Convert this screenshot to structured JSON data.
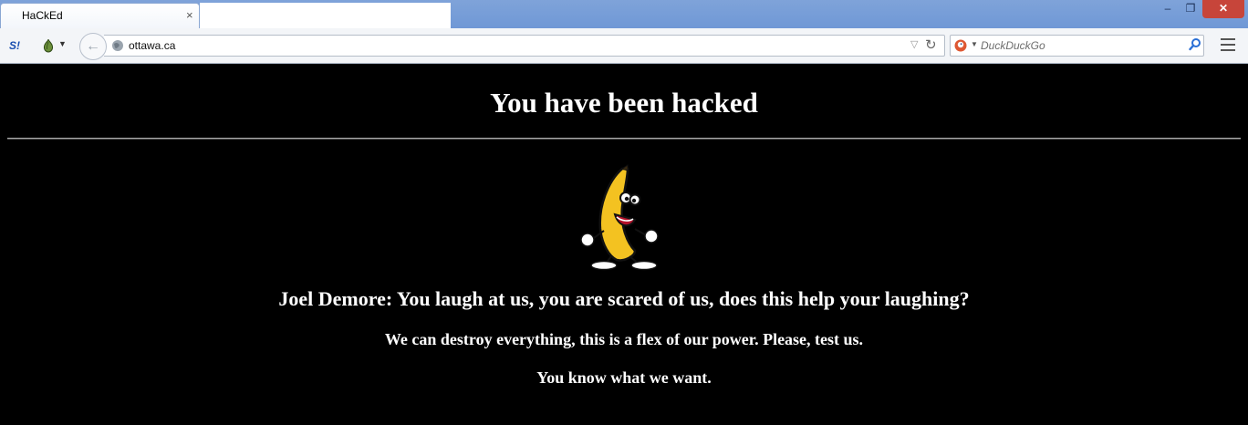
{
  "browser": {
    "tab": {
      "title": "HaCkEd",
      "close_glyph": "×"
    },
    "window_controls": {
      "minimize": "–",
      "restore": "❐",
      "close": "✕"
    },
    "toolbar": {
      "extension_label": "S!",
      "url": "ottawa.ca",
      "search_placeholder": "DuckDuckGo",
      "icons": [
        "s-extension-icon",
        "onion-icon",
        "back-arrow-icon",
        "globe-icon",
        "dropdown-arrow-icon",
        "reload-icon",
        "duckduckgo-icon",
        "search-icon",
        "hamburger-menu-icon"
      ]
    },
    "colors": {
      "titlebar": "#7fa3d9",
      "close_button": "#c7453a",
      "page_background": "#000000",
      "page_text": "#ffffff"
    }
  },
  "page": {
    "heading": "You have been hacked",
    "image": "dancing-banana",
    "message_1": "Joel Demore: You laugh at us, you are scared of us, does this help your laughing?",
    "message_2": "We can destroy everything, this is a flex of our power. Please, test us.",
    "message_3": "You know what we want."
  }
}
